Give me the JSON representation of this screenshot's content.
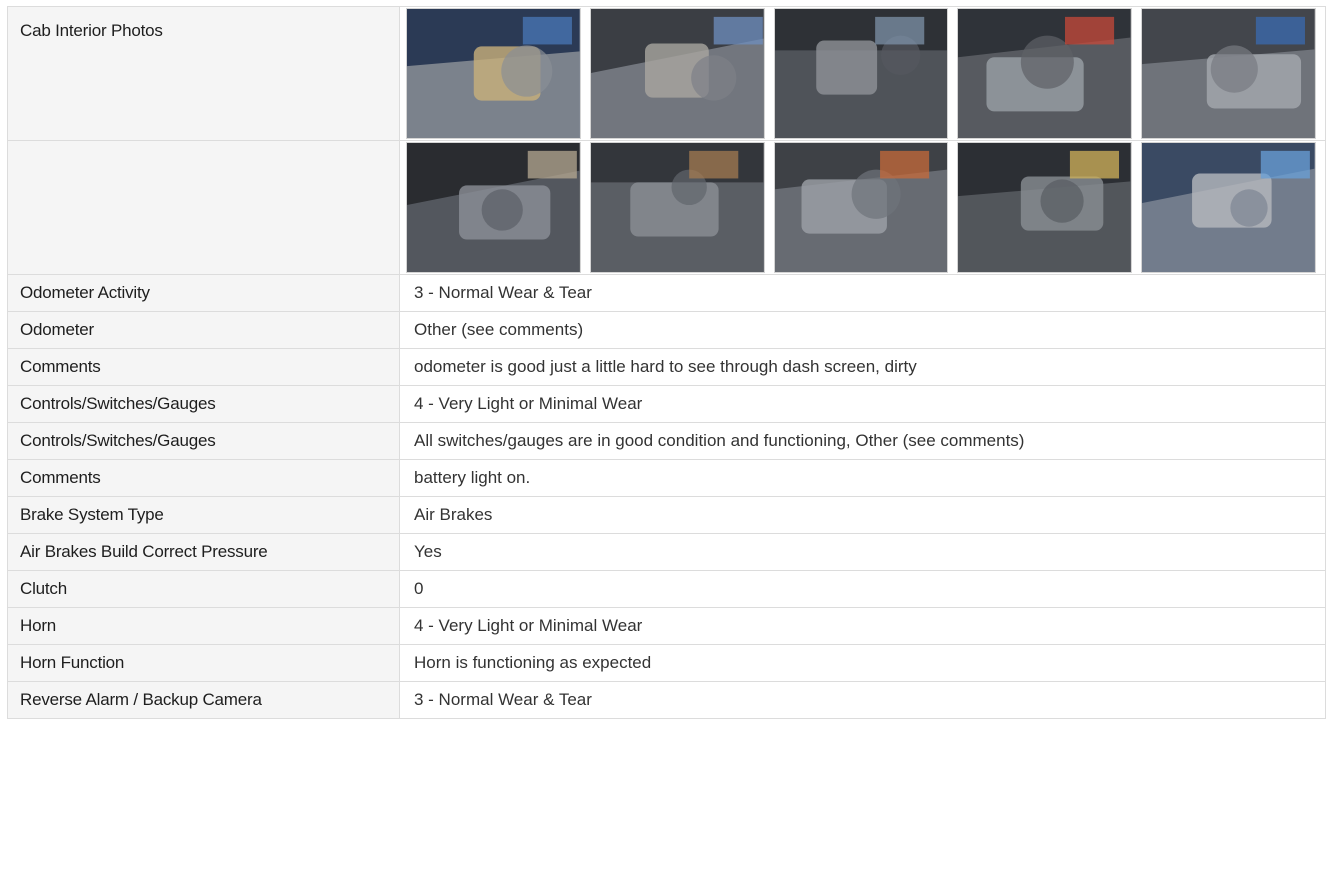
{
  "photo_section": {
    "label": "Cab Interior Photos",
    "row1": [
      {
        "icon": "cab-interior-seat-photo",
        "colors": [
          "#2b3a55",
          "#8a8f96",
          "#c9b07a",
          "#4a78b8"
        ]
      },
      {
        "icon": "dashboard-seat-photo",
        "colors": [
          "#3b3e44",
          "#7d8088",
          "#a9a6a0",
          "#6f8fbf"
        ]
      },
      {
        "icon": "glovebox-panel-photo",
        "colors": [
          "#2e3136",
          "#55595f",
          "#8e9297",
          "#7e91a8"
        ]
      },
      {
        "icon": "center-console-photo",
        "colors": [
          "#2f3339",
          "#5e6167",
          "#9aa0a6",
          "#c84a3a"
        ]
      },
      {
        "icon": "floor-shifter-photo",
        "colors": [
          "#43464c",
          "#777b82",
          "#a5a9af",
          "#3a6bb0"
        ]
      }
    ],
    "row2": [
      {
        "icon": "steering-wheel-photo",
        "colors": [
          "#2a2c30",
          "#5b5f66",
          "#8c9097",
          "#b5a892"
        ]
      },
      {
        "icon": "pedals-floor-photo",
        "colors": [
          "#33363b",
          "#61656c",
          "#8b8f95",
          "#a47b52"
        ]
      },
      {
        "icon": "door-panel-photo",
        "colors": [
          "#3e4146",
          "#6f737a",
          "#9da1a7",
          "#c76a3a"
        ]
      },
      {
        "icon": "driver-seat-photo",
        "colors": [
          "#2c2f34",
          "#595d63",
          "#8a8e94",
          "#d2b35a"
        ]
      },
      {
        "icon": "sleeper-interior-photo",
        "colors": [
          "#3a4a63",
          "#7d8593",
          "#b6b9be",
          "#6aa0d8"
        ]
      }
    ]
  },
  "rows": [
    {
      "label": "Odometer Activity",
      "value": "3 - Normal Wear & Tear"
    },
    {
      "label": "Odometer",
      "value": "Other (see comments)"
    },
    {
      "label": "Comments",
      "value": "odometer is good just a little hard to see through dash screen, dirty"
    },
    {
      "label": "Controls/Switches/Gauges",
      "value": "4 - Very Light or Minimal Wear"
    },
    {
      "label": "Controls/Switches/Gauges",
      "value": "All switches/gauges are in good condition and functioning, Other (see comments)"
    },
    {
      "label": "Comments",
      "value": "battery light on."
    },
    {
      "label": "Brake System Type",
      "value": "Air Brakes"
    },
    {
      "label": "Air Brakes Build Correct Pressure",
      "value": "Yes"
    },
    {
      "label": "Clutch",
      "value": "0"
    },
    {
      "label": "Horn",
      "value": "4 - Very Light or Minimal Wear"
    },
    {
      "label": "Horn Function",
      "value": "Horn is functioning as expected"
    },
    {
      "label": "Reverse Alarm / Backup Camera",
      "value": "3 - Normal Wear & Tear"
    }
  ]
}
